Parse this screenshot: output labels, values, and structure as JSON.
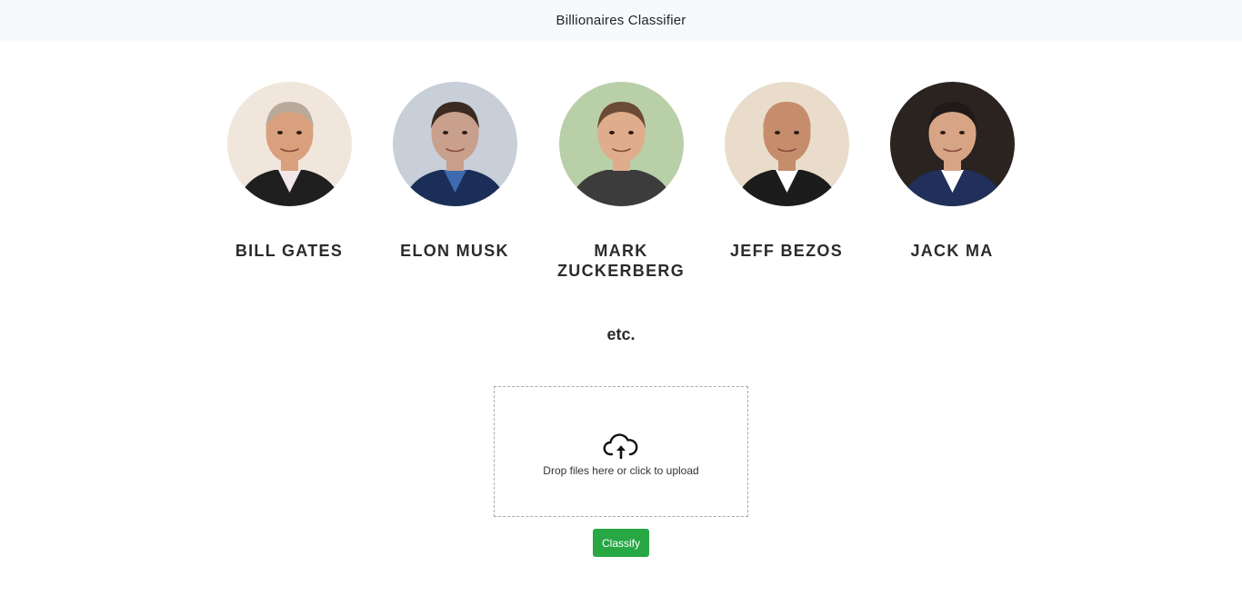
{
  "navbar": {
    "title": "Billionaires Classifier"
  },
  "people": [
    {
      "name": "Bill Gates",
      "skin": "#d9a07e",
      "hair": "#b8a99a",
      "suit": "#1f1f1f",
      "shirt": "#f3e7ea",
      "bg": "#f1e6dc"
    },
    {
      "name": "Elon Musk",
      "skin": "#c9a08c",
      "hair": "#3b2a22",
      "suit": "#1b2e57",
      "shirt": "#3f6ab0",
      "bg": "#c8cfd8"
    },
    {
      "name": "Mark Zuckerberg",
      "skin": "#e0ad8c",
      "hair": "#6b4a36",
      "suit": "#3c3c3c",
      "shirt": "#3c3c3c",
      "bg": "#b8cfa8"
    },
    {
      "name": "Jeff Bezos",
      "skin": "#c58d6c",
      "hair": "#c58d6c",
      "suit": "#1c1c1c",
      "shirt": "#ffffff",
      "bg": "#e9dccb"
    },
    {
      "name": "Jack Ma",
      "skin": "#d7a585",
      "hair": "#1f1a18",
      "suit": "#20305a",
      "shirt": "#ffffff",
      "bg": "#2a2320"
    }
  ],
  "etc_text": "etc.",
  "dropzone": {
    "text": "Drop files here or click to upload",
    "icon": "cloud-upload-icon"
  },
  "classify": {
    "label": "Classify"
  },
  "colors": {
    "accent": "#28a745",
    "navbar_bg": "#f8f9fa"
  }
}
